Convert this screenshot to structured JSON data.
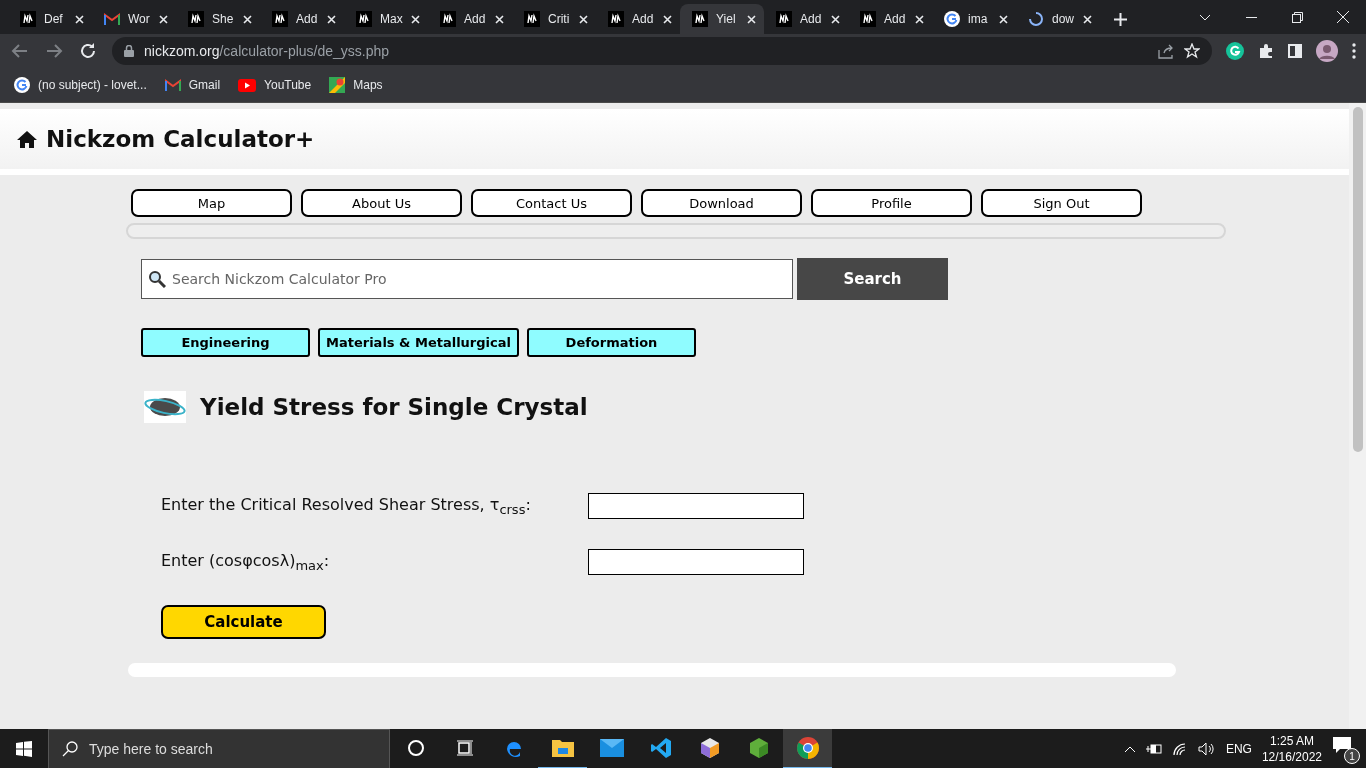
{
  "browser": {
    "tabs": [
      {
        "title": "Def",
        "kind": "nickzom",
        "selected": false
      },
      {
        "title": "Wor",
        "kind": "gmail",
        "selected": false
      },
      {
        "title": "She",
        "kind": "nickzom",
        "selected": false
      },
      {
        "title": "Add",
        "kind": "nickzom",
        "selected": false
      },
      {
        "title": "Max",
        "kind": "nickzom",
        "selected": false
      },
      {
        "title": "Add",
        "kind": "nickzom",
        "selected": false
      },
      {
        "title": "Criti",
        "kind": "nickzom",
        "selected": false
      },
      {
        "title": "Add",
        "kind": "nickzom",
        "selected": false
      },
      {
        "title": "Yiel",
        "kind": "nickzom",
        "selected": true
      },
      {
        "title": "Add",
        "kind": "nickzom",
        "selected": false
      },
      {
        "title": "Add",
        "kind": "nickzom",
        "selected": false
      },
      {
        "title": "ima",
        "kind": "google",
        "selected": false
      },
      {
        "title": "dow",
        "kind": "loading",
        "selected": false
      }
    ],
    "url_host": "nickzom.org",
    "url_path": "/calculator-plus/de_yss.php",
    "bookmarks": [
      {
        "label": "(no subject) - lovet...",
        "kind": "google"
      },
      {
        "label": "Gmail",
        "kind": "gmail"
      },
      {
        "label": "YouTube",
        "kind": "youtube"
      },
      {
        "label": "Maps",
        "kind": "maps"
      }
    ]
  },
  "page": {
    "site_title": "Nickzom Calculator+",
    "nav": [
      "Map",
      "About Us",
      "Contact Us",
      "Download",
      "Profile",
      "Sign Out"
    ],
    "search": {
      "placeholder": "Search Nickzom Calculator Pro",
      "button": "Search"
    },
    "categories": [
      "Engineering",
      "Materials & Metallurgical",
      "Deformation"
    ],
    "title": "Yield Stress for Single Crystal",
    "fields": [
      {
        "label": "Enter the Critical Resolved Shear Stress, τ$_{crss}$:"
      },
      {
        "label": "Enter (cosφcosλ)$_{max}$:"
      }
    ],
    "calculate": "Calculate"
  },
  "taskbar": {
    "search_placeholder": "Type here to search",
    "apps": [
      {
        "kind": "cortana",
        "running": false,
        "active": false
      },
      {
        "kind": "taskview",
        "running": false,
        "active": false
      },
      {
        "kind": "edge",
        "running": false,
        "active": false
      },
      {
        "kind": "folder",
        "running": true,
        "active": false
      },
      {
        "kind": "mail",
        "running": false,
        "active": false
      },
      {
        "kind": "vscode",
        "running": false,
        "active": false
      },
      {
        "kind": "cube",
        "running": false,
        "active": false
      },
      {
        "kind": "hexagon",
        "running": false,
        "active": false
      },
      {
        "kind": "chrome",
        "running": true,
        "active": true
      }
    ],
    "language": "ENG",
    "time": "1:25 AM",
    "date": "12/16/2022",
    "notifications": "1"
  }
}
